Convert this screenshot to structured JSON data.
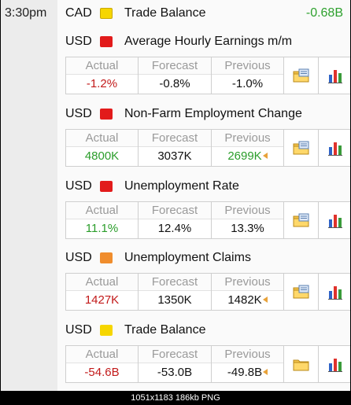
{
  "time_label": "3:30pm",
  "top_event": {
    "currency": "CAD",
    "flag_color": "#f6d600",
    "title": "Trade Balance",
    "actual": "-0.68B"
  },
  "events": [
    {
      "currency": "USD",
      "impact": "high",
      "title": "Average Hourly Earnings m/m",
      "labels": {
        "actual": "Actual",
        "forecast": "Forecast",
        "previous": "Previous"
      },
      "actual": "-1.2%",
      "actual_tone": "red",
      "forecast": "-0.8%",
      "previous": "-1.0%",
      "previous_tone": "black",
      "previous_revised": false,
      "actions": [
        "news-folder-icon",
        "bar-chart-icon"
      ]
    },
    {
      "currency": "USD",
      "impact": "high",
      "title": "Non-Farm Employment Change",
      "labels": {
        "actual": "Actual",
        "forecast": "Forecast",
        "previous": "Previous"
      },
      "actual": "4800K",
      "actual_tone": "green",
      "forecast": "3037K",
      "previous": "2699K",
      "previous_tone": "green",
      "previous_revised": true,
      "actions": [
        "news-folder-icon",
        "bar-chart-icon"
      ]
    },
    {
      "currency": "USD",
      "impact": "high",
      "title": "Unemployment Rate",
      "labels": {
        "actual": "Actual",
        "forecast": "Forecast",
        "previous": "Previous"
      },
      "actual": "11.1%",
      "actual_tone": "green",
      "forecast": "12.4%",
      "previous": "13.3%",
      "previous_tone": "black",
      "previous_revised": false,
      "actions": [
        "news-folder-icon",
        "bar-chart-icon"
      ]
    },
    {
      "currency": "USD",
      "impact": "medium",
      "title": "Unemployment Claims",
      "labels": {
        "actual": "Actual",
        "forecast": "Forecast",
        "previous": "Previous"
      },
      "actual": "1427K",
      "actual_tone": "red",
      "forecast": "1350K",
      "previous": "1482K",
      "previous_tone": "black",
      "previous_revised": true,
      "actions": [
        "news-folder-icon",
        "bar-chart-icon"
      ]
    },
    {
      "currency": "USD",
      "impact": "low",
      "title": "Trade Balance",
      "labels": {
        "actual": "Actual",
        "forecast": "Forecast",
        "previous": "Previous"
      },
      "actual": "-54.6B",
      "actual_tone": "red",
      "forecast": "-53.0B",
      "previous": "-49.8B",
      "previous_tone": "black",
      "previous_revised": true,
      "actions": [
        "folder-icon",
        "bar-chart-icon"
      ]
    }
  ],
  "impact_colors": {
    "high": "#e21b1b",
    "medium": "#f08d2d",
    "low": "#f6d600"
  },
  "statusbar": "1051x1183  186kb  PNG"
}
